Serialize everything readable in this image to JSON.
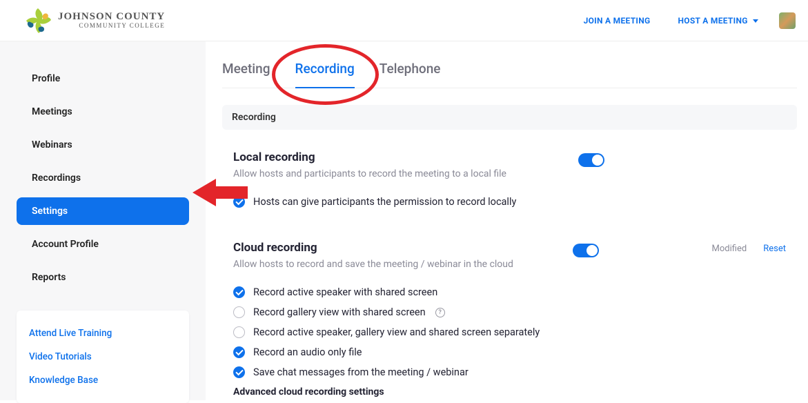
{
  "header": {
    "logo_main": "JOHNSON COUNTY",
    "logo_sub": "COMMUNITY COLLEGE",
    "join_label": "JOIN A MEETING",
    "host_label": "HOST A MEETING"
  },
  "sidebar": {
    "items": [
      {
        "label": "Profile"
      },
      {
        "label": "Meetings"
      },
      {
        "label": "Webinars"
      },
      {
        "label": "Recordings"
      },
      {
        "label": "Settings"
      },
      {
        "label": "Account Profile"
      },
      {
        "label": "Reports"
      }
    ],
    "help": {
      "live_training": "Attend Live Training",
      "video_tutorials": "Video Tutorials",
      "knowledge_base": "Knowledge Base"
    }
  },
  "tabs": {
    "meeting": "Meeting",
    "recording": "Recording",
    "telephone": "Telephone"
  },
  "section_header": "Recording",
  "local": {
    "title": "Local recording",
    "desc": "Allow hosts and participants to record the meeting to a local file",
    "opt_hosts_permission": "Hosts can give participants the permission to record locally"
  },
  "cloud": {
    "title": "Cloud recording",
    "desc": "Allow hosts to record and save the meeting / webinar in the cloud",
    "modified": "Modified",
    "reset": "Reset",
    "opt_active_speaker": "Record active speaker with shared screen",
    "opt_gallery_view": "Record gallery view with shared screen",
    "opt_separately": "Record active speaker, gallery view and shared screen separately",
    "opt_audio_only": "Record an audio only file",
    "opt_chat": "Save chat messages from the meeting / webinar",
    "advanced_title": "Advanced cloud recording settings"
  }
}
